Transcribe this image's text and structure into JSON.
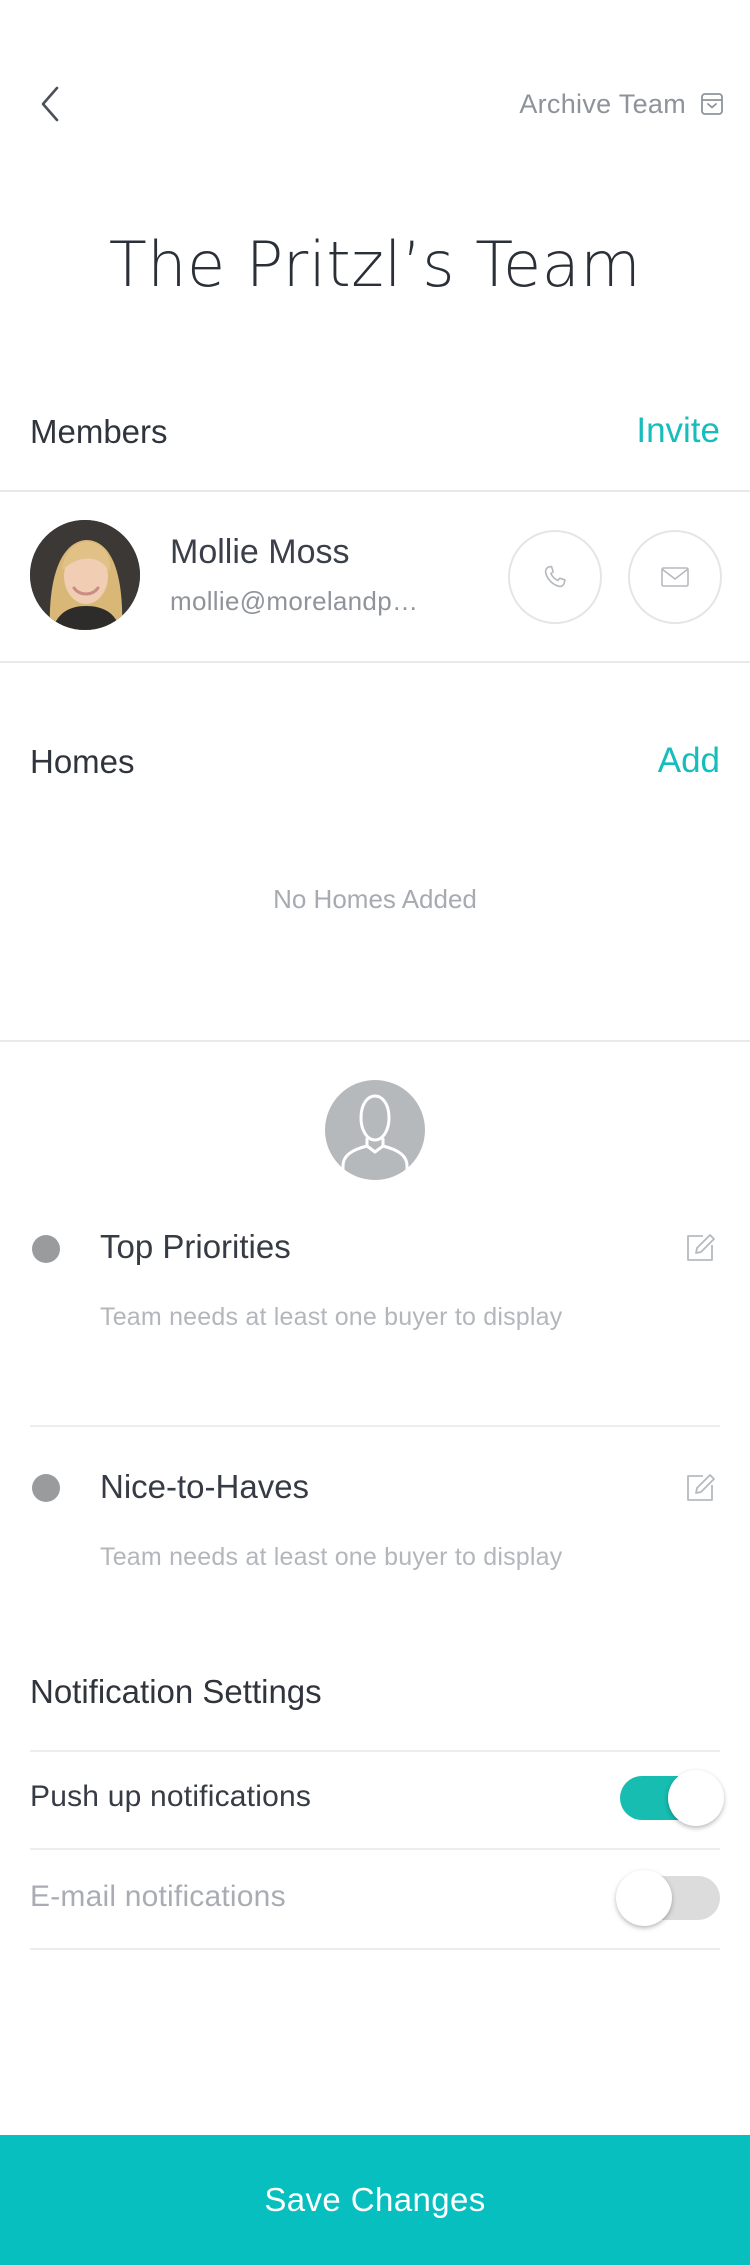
{
  "header": {
    "back_icon": "chevron-left-icon",
    "archive_label": "Archive Team",
    "archive_icon": "archive-box-icon"
  },
  "title": "The Pritzl’s Team",
  "members": {
    "label": "Members",
    "action": "Invite",
    "items": [
      {
        "name": "Mollie Moss",
        "email": "mollie@morelandp…",
        "call_icon": "phone-icon",
        "mail_icon": "mail-icon"
      }
    ]
  },
  "homes": {
    "label": "Homes",
    "action": "Add",
    "empty_text": "No Homes Added"
  },
  "preferences": {
    "buyer_icon": "user-silhouette-icon",
    "items": [
      {
        "title": "Top Priorities",
        "note": "Team needs at least one buyer to display",
        "edit_icon": "edit-icon"
      },
      {
        "title": "Nice-to-Haves",
        "note": "Team needs at least one buyer to display",
        "edit_icon": "edit-icon"
      }
    ]
  },
  "notifications": {
    "title": "Notification Settings",
    "items": [
      {
        "label": "Push up notifications",
        "enabled": true
      },
      {
        "label": "E-mail notifications",
        "enabled": false
      }
    ]
  },
  "footer": {
    "save_label": "Save Changes"
  },
  "colors": {
    "accent": "#16bdbc",
    "save_bar": "#08bfbf",
    "toggle_on": "#16bdb0",
    "toggle_off": "#dcdcdd",
    "dot": "#9a9b9d"
  }
}
